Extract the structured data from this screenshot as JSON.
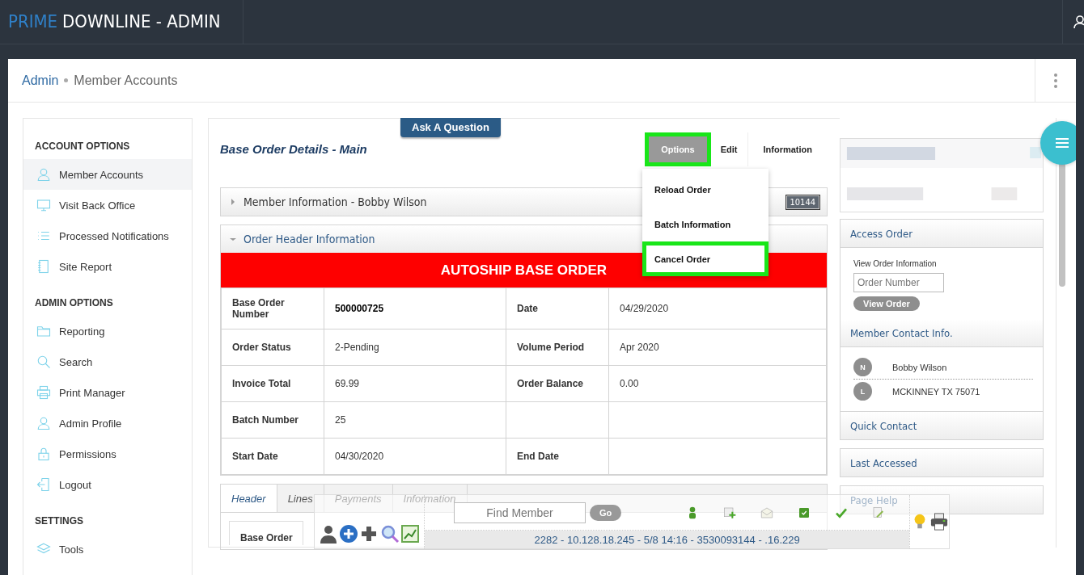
{
  "header": {
    "brand_accent": "PRIME",
    "brand_rest": "DOWNLINE - ADMIN"
  },
  "breadcrumb": [
    {
      "label": "Admin",
      "kind": "link"
    },
    {
      "label": "Member Accounts",
      "kind": "current"
    }
  ],
  "sidebar": {
    "sections": [
      {
        "title": "ACCOUNT OPTIONS",
        "items": [
          {
            "label": "Member Accounts",
            "kind": "user",
            "selected": true
          },
          {
            "label": "Visit Back Office",
            "kind": "monitor",
            "selected": false
          },
          {
            "label": "Processed Notifications",
            "kind": "list",
            "selected": false
          },
          {
            "label": "Site Report",
            "kind": "notebook",
            "selected": false
          }
        ]
      },
      {
        "title": "ADMIN OPTIONS",
        "items": [
          {
            "label": "Reporting",
            "kind": "folder",
            "selected": false
          },
          {
            "label": "Search",
            "kind": "search",
            "selected": false
          },
          {
            "label": "Print Manager",
            "kind": "printer",
            "selected": false
          },
          {
            "label": "Admin Profile",
            "kind": "user",
            "selected": false
          },
          {
            "label": "Permissions",
            "kind": "lock",
            "selected": false
          },
          {
            "label": "Logout",
            "kind": "logout",
            "selected": false
          }
        ]
      },
      {
        "title": "SETTINGS",
        "items": [
          {
            "label": "Tools",
            "kind": "layers",
            "selected": false
          }
        ]
      }
    ]
  },
  "main": {
    "ask_button": "Ask A Question",
    "title": "Base Order Details - Main",
    "tabs": [
      {
        "label": "Options",
        "selected": true,
        "highlighted": true
      },
      {
        "label": "Edit",
        "selected": false,
        "highlighted": false
      },
      {
        "label": "Information",
        "selected": false,
        "highlighted": false
      }
    ],
    "options_menu": [
      {
        "label": "Reload Order",
        "highlighted": false
      },
      {
        "label": "Batch Information",
        "highlighted": false
      },
      {
        "label": "Cancel Order",
        "highlighted": true
      }
    ],
    "panels": [
      {
        "title": "Member Information - Bobby Wilson",
        "expanded": false,
        "badge": "10144"
      },
      {
        "title": "Order Header Information",
        "expanded": true
      }
    ],
    "banner": "AUTOSHIP BASE ORDER",
    "order_table": {
      "rows": [
        [
          {
            "kind": "label",
            "text": "Base Order Number"
          },
          {
            "kind": "value",
            "text": "500000725",
            "bold": true
          },
          {
            "kind": "label",
            "text": "Date"
          },
          {
            "kind": "value",
            "text": "04/29/2020"
          }
        ],
        [
          {
            "kind": "label",
            "text": "Order Status"
          },
          {
            "kind": "value",
            "text": "2-Pending"
          },
          {
            "kind": "label",
            "text": "Volume Period"
          },
          {
            "kind": "value",
            "text": "Apr 2020"
          }
        ],
        [
          {
            "kind": "label",
            "text": "Invoice Total"
          },
          {
            "kind": "value",
            "text": "69.99"
          },
          {
            "kind": "label",
            "text": "Order Balance"
          },
          {
            "kind": "value",
            "text": "0.00"
          }
        ],
        [
          {
            "kind": "label",
            "text": "Batch Number"
          },
          {
            "kind": "value",
            "text": "25"
          },
          {
            "kind": "empty"
          },
          {
            "kind": "empty"
          }
        ],
        [
          {
            "kind": "label",
            "text": "Start Date"
          },
          {
            "kind": "value",
            "text": "04/30/2020"
          },
          {
            "kind": "label",
            "text": "End Date"
          },
          {
            "kind": "empty"
          }
        ]
      ]
    },
    "detail_tabs": [
      {
        "label": "Header",
        "selected": true
      },
      {
        "label": "Lines",
        "selected": false
      },
      {
        "label": "Payments",
        "selected": false
      },
      {
        "label": "Information",
        "selected": false
      }
    ],
    "detail_label": "Base Order"
  },
  "right": {
    "access_order": {
      "title": "Access Order",
      "caption": "View Order Information",
      "placeholder": "Order Number",
      "button": "View Order"
    },
    "contact": {
      "title": "Member Contact Info.",
      "rows": [
        {
          "badge": "N",
          "text": "Bobby Wilson"
        },
        {
          "badge": "L",
          "text": "MCKINNEY TX 75071"
        }
      ]
    },
    "quick_contact": "Quick Contact",
    "panels": [
      "Last Accessed",
      "Page Help"
    ]
  },
  "toolbar": {
    "search_placeholder": "Find Member",
    "go_button": "Go",
    "status": "2282 - 10.128.18.245 - 5/8 14:16 - 3530093144 - .16.229"
  }
}
